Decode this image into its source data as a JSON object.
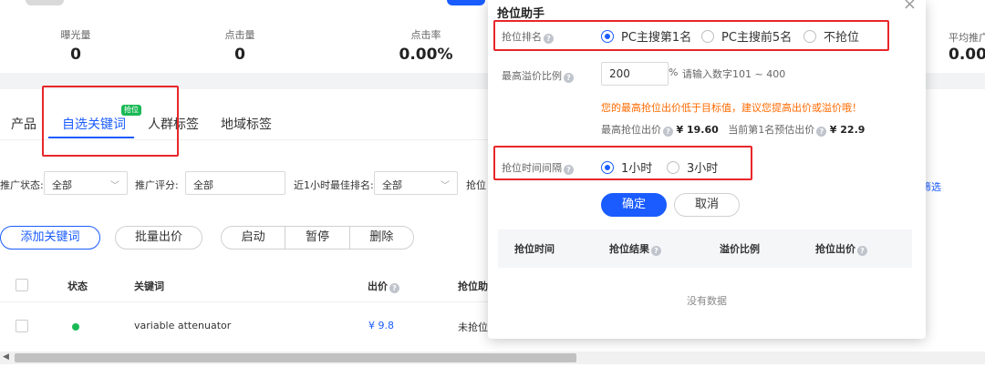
{
  "stats": [
    {
      "label": "曝光量",
      "value": "0"
    },
    {
      "label": "点击量",
      "value": "0"
    },
    {
      "label": "点击率",
      "value": "0.00%"
    }
  ],
  "stats_right": {
    "label": "平均推广",
    "value": "0.00"
  },
  "tabs": [
    {
      "label": "产品"
    },
    {
      "label": "自选关键词",
      "badge": "抢位"
    },
    {
      "label": "人群标签"
    },
    {
      "label": "地域标签"
    }
  ],
  "filters": {
    "status_label": "推广状态:",
    "status_value": "全部",
    "score_label": "推广评分:",
    "score_value": "全部",
    "rank_label": "近1小时最佳排名:",
    "rank_value": "全部",
    "bid_label": "抢位",
    "right_link": "筛选"
  },
  "actions": {
    "add_keyword": "添加关键词",
    "batch_bid": "批量出价",
    "start": "启动",
    "pause": "暂停",
    "delete": "删除"
  },
  "table": {
    "headers": {
      "status": "状态",
      "keyword": "关键词",
      "bid": "出价",
      "assist": "抢位助"
    },
    "rows": [
      {
        "keyword": "variable attenuator",
        "bid": "¥ 9.8",
        "assist": "未抢位"
      }
    ]
  },
  "modal": {
    "title": "抢位助手",
    "close": "×",
    "rank_label": "抢位排名",
    "rank_options": [
      "PC主搜第1名",
      "PC主搜前5名",
      "不抢位"
    ],
    "max_ratio_label": "最高溢价比例",
    "max_ratio_value": "200",
    "percent": "%",
    "ratio_hint": "请输入数字101 ~ 400",
    "warning": "您的最高抢位出价低于目标值，建议您提高出价或溢价哦！",
    "max_bid_label": "最高抢位出价",
    "max_bid_value": "¥ 19.60",
    "est_label": "当前第1名预估出价",
    "est_value": "¥ 22.9",
    "interval_label": "抢位时间间隔",
    "interval_options": [
      "1小时",
      "3小时"
    ],
    "ok": "确定",
    "cancel": "取消",
    "table_headers": [
      "抢位时间",
      "抢位结果",
      "溢价比例",
      "抢位出价"
    ],
    "empty": "没有数据"
  },
  "colors": {
    "accent": "#1a5cff",
    "warning": "#ff6a00",
    "success": "#19b955",
    "highlight": "#e8262a"
  }
}
